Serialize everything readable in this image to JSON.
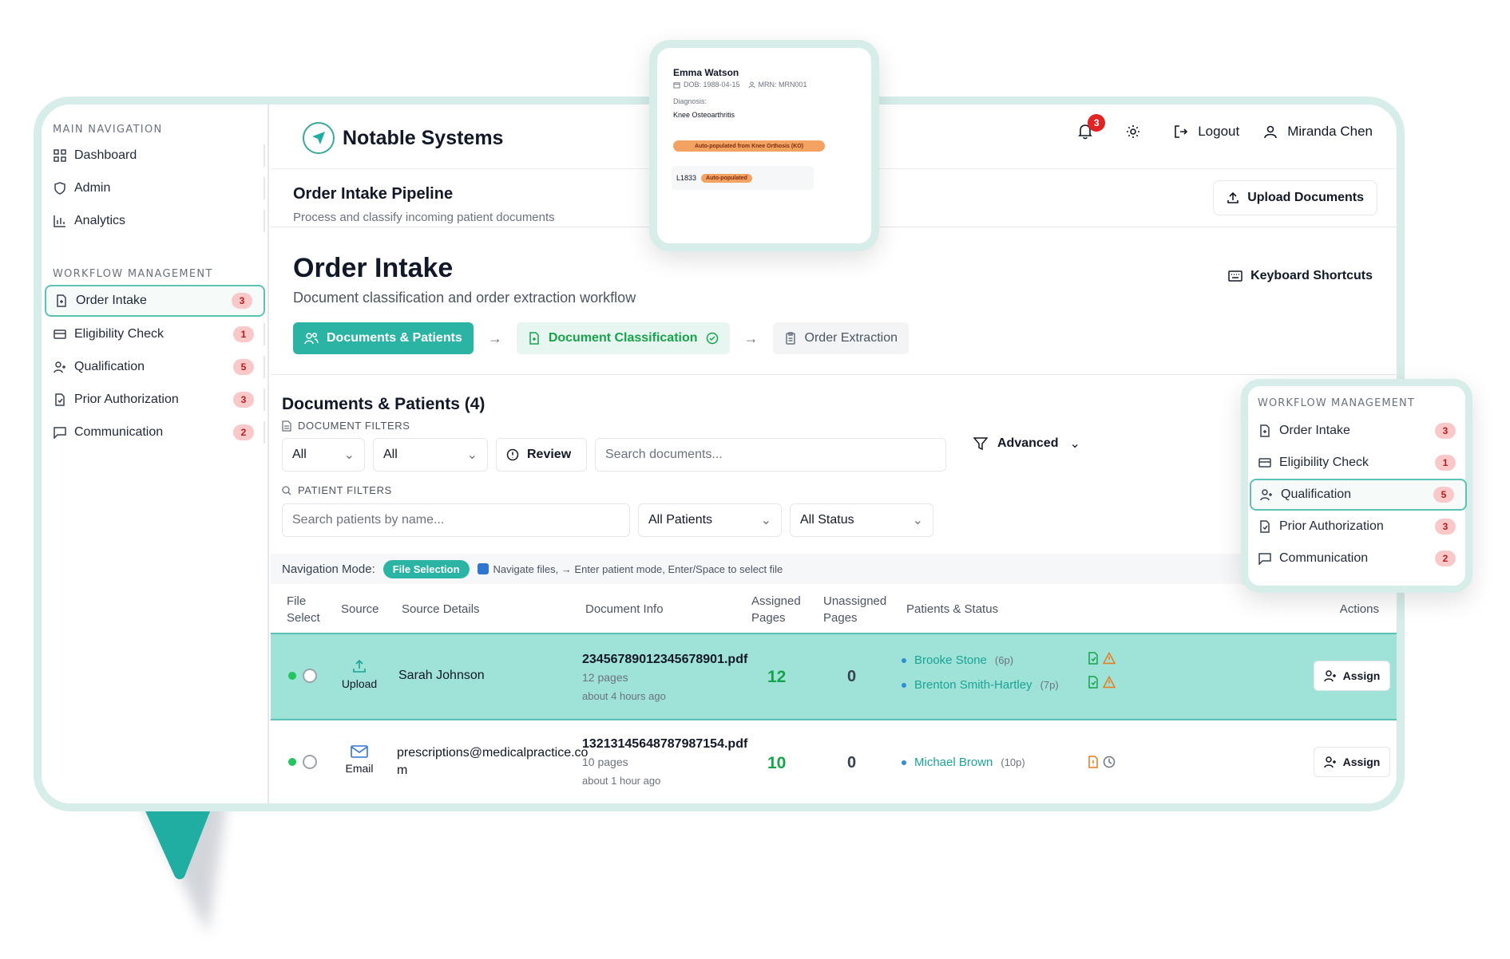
{
  "sidebar": {
    "main_title": "MAIN NAVIGATION",
    "main_items": [
      {
        "label": "Dashboard",
        "icon": "grid-icon"
      },
      {
        "label": "Admin",
        "icon": "shield-icon"
      },
      {
        "label": "Analytics",
        "icon": "bar-chart-icon"
      }
    ],
    "workflow_title": "WORKFLOW MANAGEMENT",
    "workflow_items": [
      {
        "label": "Order Intake",
        "count": "3",
        "icon": "file-icon",
        "active": true
      },
      {
        "label": "Eligibility Check",
        "count": "1",
        "icon": "card-icon"
      },
      {
        "label": "Qualification",
        "count": "5",
        "icon": "user-plus-icon"
      },
      {
        "label": "Prior Authorization",
        "count": "3",
        "icon": "file-check-icon"
      },
      {
        "label": "Communication",
        "count": "2",
        "icon": "message-icon"
      }
    ]
  },
  "header": {
    "brand": "Notable Systems",
    "notif_count": "3",
    "logout": "Logout",
    "user": "Miranda Chen"
  },
  "pipeline": {
    "title": "Order Intake Pipeline",
    "subtitle": "Process and classify incoming patient documents",
    "upload_btn": "Upload Documents"
  },
  "order_intake": {
    "title": "Order Intake",
    "subtitle": "Document classification and order extraction workflow",
    "shortcuts": "Keyboard Shortcuts",
    "steps": [
      "Documents & Patients",
      "Document Classification",
      "Order Extraction"
    ]
  },
  "documents": {
    "title": "Documents & Patients (4)",
    "doc_filters_label": "DOCUMENT FILTERS",
    "filter_1": "All",
    "filter_2": "All",
    "review": "Review",
    "search_docs_placeholder": "Search documents...",
    "advanced": "Advanced",
    "patient_filters_label": "PATIENT FILTERS",
    "search_patients_placeholder": "Search patients by name...",
    "all_patients": "All Patients",
    "all_status": "All Status",
    "nav_mode_label": "Navigation Mode:",
    "nav_mode_value": "File Selection",
    "nav_hint": "Navigate files, → Enter patient mode, Enter/Space to select file"
  },
  "table": {
    "headers": {
      "file_select_1": "File",
      "file_select_2": "Select",
      "source": "Source",
      "source_details": "Source Details",
      "document_info": "Document Info",
      "assigned_1": "Assigned",
      "assigned_2": "Pages",
      "unassigned_1": "Unassigned",
      "unassigned_2": "Pages",
      "patients_status": "Patients & Status",
      "actions": "Actions"
    },
    "rows": [
      {
        "source": "Upload",
        "source_details": "Sarah Johnson",
        "file": "23456789012345678901.pdf",
        "pages": "12 pages",
        "time": "about 4 hours ago",
        "assigned": "12",
        "unassigned": "0",
        "patients": [
          {
            "name": "Brooke Stone",
            "pages": "(6p)"
          },
          {
            "name": "Brenton Smith-Hartley",
            "pages": "(7p)"
          }
        ],
        "action": "Assign"
      },
      {
        "source": "Email",
        "source_details_line1": "prescriptions@medicalpractice.co",
        "source_details_line2": "m",
        "file": "13213145648787987154.pdf",
        "pages": "10 pages",
        "time": "about 1 hour ago",
        "assigned": "10",
        "unassigned": "0",
        "patients": [
          {
            "name": "Michael Brown",
            "pages": "(10p)"
          }
        ],
        "action": "Assign"
      }
    ]
  },
  "popover": {
    "name": "Emma Watson",
    "dob": "DOB: 1988-04-15",
    "mrn": "MRN: MRN001",
    "diagnosis_label": "Diagnosis:",
    "diagnosis": "Knee Osteoarthritis",
    "auto_tag": "Auto-populated from Knee Orthosis (KO)",
    "code": "L1833",
    "code_tag": "Auto-populated"
  },
  "colors": {
    "accent": "#2bb3a3",
    "frame": "#d6ede9",
    "selected_row": "#9fe3d8",
    "badge_bg": "#f9c9c9",
    "badge_text": "#b91c1c"
  }
}
